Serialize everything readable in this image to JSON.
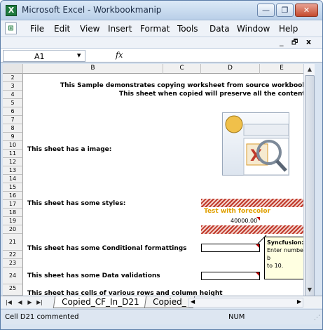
{
  "window": {
    "title": "Microsoft Excel - Workbookmanip",
    "app_icon": "excel-icon"
  },
  "titlebar_buttons": {
    "minimize": "—",
    "restore": "❐",
    "close": "✕"
  },
  "menu": [
    "File",
    "Edit",
    "View",
    "Insert",
    "Format",
    "Tools",
    "Data",
    "Window",
    "Help"
  ],
  "doc_controls": {
    "minimize": "_",
    "restore": "🗗",
    "close": "x"
  },
  "formula_bar": {
    "cell_ref": "A1",
    "fx": "fx",
    "value": ""
  },
  "columns": [
    "B",
    "C",
    "D",
    "E"
  ],
  "rows": [
    "2",
    "3",
    "4",
    "5",
    "6",
    "7",
    "8",
    "9",
    "10",
    "11",
    "12",
    "13",
    "14",
    "15",
    "16",
    "17",
    "18",
    "19",
    "20",
    "21",
    "22",
    "23",
    "24",
    "25"
  ],
  "sheet": {
    "header_line1": "This Sample demonstrates copying worksheet from source workbook",
    "header_line2": "This sheet when copied will preserve all the contents",
    "image_label": "This sheet has a image:",
    "styles_label": "This sheet has some styles:",
    "styled_text": "Test with forecolor",
    "styled_number": "40000.00",
    "cond_format_label": "This sheet has some Conditional formattings",
    "validation_label": "This sheet has some Data validations",
    "rows_label": "This sheet has cells of various rows and column height",
    "comment_title": "Syncfusion:",
    "comment_line1": "Enter number b",
    "comment_line2": "to 10."
  },
  "tabs": [
    "Copied_CF_In_D21",
    "Copied_"
  ],
  "status": {
    "left": "Cell D21 commented",
    "mode": "NUM"
  },
  "colors": {
    "accent_red": "#c0392b",
    "forecolor_text": "#e0a000",
    "comment_bg": "#ffffe1"
  }
}
